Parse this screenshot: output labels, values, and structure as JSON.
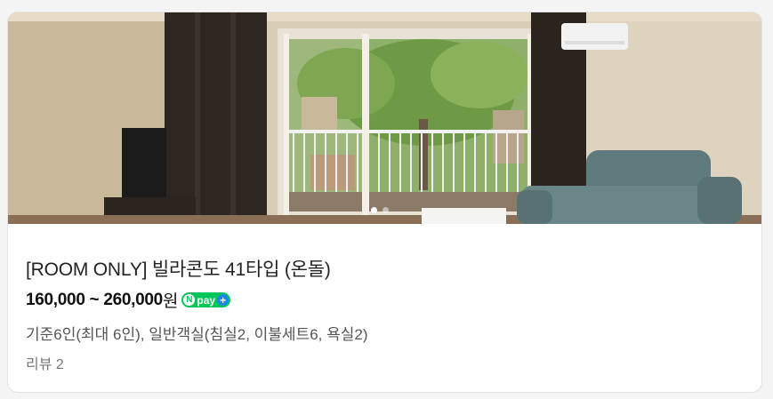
{
  "listing": {
    "title": "[ROOM ONLY] 빌라콘도 41타입 (온돌)",
    "price": "160,000 ~ 260,000",
    "price_unit": "원",
    "npay": {
      "n": "N",
      "label": "pay",
      "plus": "+"
    },
    "description": "기준6인(최대 6인), 일반객실(침실2, 이불세트6, 욕실2)",
    "reviews": "리뷰 2"
  },
  "gallery": {
    "image": "room-photo",
    "slide_count": 2,
    "current_slide": 1
  },
  "colors": {
    "npay_green": "#03c75a",
    "npay_blue": "#1e88e5",
    "title_text": "#222222",
    "muted_text": "#777777"
  }
}
